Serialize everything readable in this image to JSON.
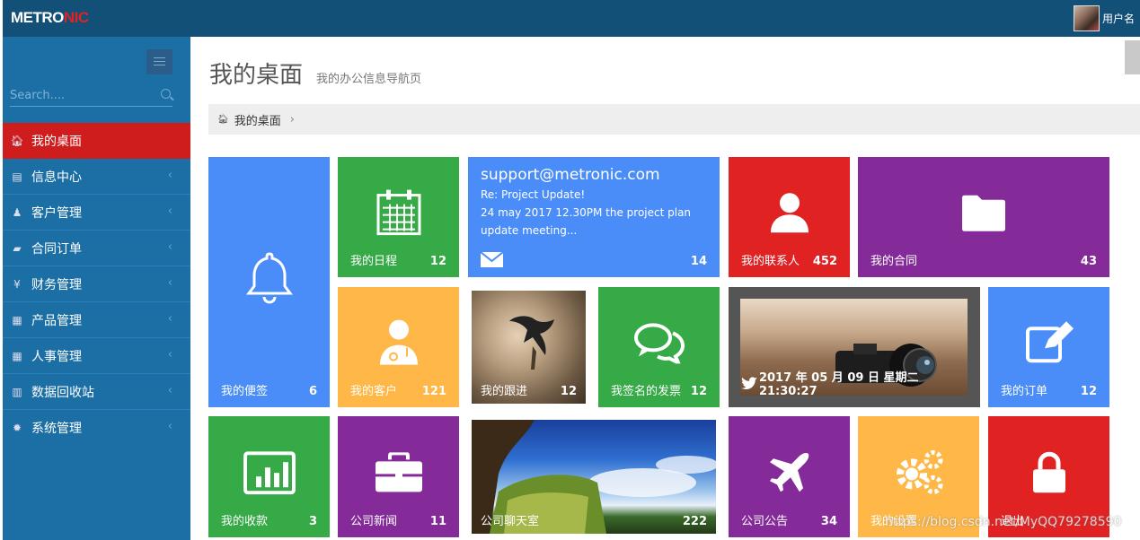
{
  "header": {
    "logo_part1": "METRO",
    "logo_part2": "NIC",
    "username": "用户名"
  },
  "sidebar": {
    "search_placeholder": "Search....",
    "items": [
      {
        "label": "我的桌面",
        "icon": "home-icon",
        "active": true
      },
      {
        "label": "信息中心",
        "icon": "file-icon"
      },
      {
        "label": "客户管理",
        "icon": "user-icon"
      },
      {
        "label": "合同订单",
        "icon": "book-icon"
      },
      {
        "label": "财务管理",
        "icon": "yen-icon"
      },
      {
        "label": "产品管理",
        "icon": "table-icon"
      },
      {
        "label": "人事管理",
        "icon": "table-icon"
      },
      {
        "label": "数据回收站",
        "icon": "trash-icon"
      },
      {
        "label": "系统管理",
        "icon": "gear-icon"
      }
    ]
  },
  "page": {
    "title": "我的桌面",
    "subtitle": "我的办公信息导航页",
    "breadcrumb": "我的桌面"
  },
  "tiles": {
    "notes": {
      "label": "我的便签",
      "count": "6"
    },
    "schedule": {
      "label": "我的日程",
      "count": "12"
    },
    "mail": {
      "from": "support@metronic.com",
      "subject": "Re: Project Update!",
      "line1": "24 may 2017 12.30PM the project plan",
      "line2": "update meeting...",
      "count": "14"
    },
    "contacts": {
      "label": "我的联系人",
      "count": "452"
    },
    "contracts": {
      "label": "我的合同",
      "count": "43"
    },
    "customers": {
      "label": "我的客户",
      "count": "121"
    },
    "followup": {
      "label": "我的跟进",
      "count": "12"
    },
    "invoices": {
      "label": "我签名的发票",
      "count": "12"
    },
    "datetime": {
      "text": "2017 年 05 月 09 日 星期二 21:30:27"
    },
    "orders": {
      "label": "我的订单",
      "count": "12"
    },
    "payments": {
      "label": "我的收款",
      "count": "3"
    },
    "news": {
      "label": "公司新闻",
      "count": "11"
    },
    "chat": {
      "label": "公司聊天室",
      "count": "222"
    },
    "notice": {
      "label": "公司公告",
      "count": "34"
    },
    "settings": {
      "label": "我的设置"
    },
    "logout": {
      "label": "退出"
    }
  },
  "watermark": "https://blog.csdn.net/MyQQ79278590",
  "colors": {
    "blue": "#4b8df8",
    "green": "#35aa47",
    "red": "#e02222",
    "purple": "#852b99",
    "yellow": "#ffb848",
    "sidebar": "#1c6fa5",
    "topbar": "#135078"
  }
}
